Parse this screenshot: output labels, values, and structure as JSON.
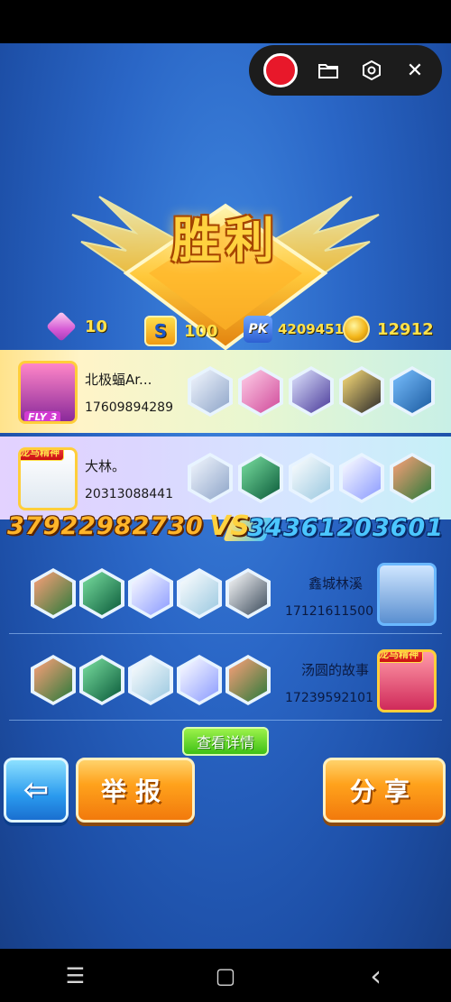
{
  "recorder": {
    "icons": [
      "record-icon",
      "folder-icon",
      "settings-icon",
      "close-icon"
    ],
    "close_glyph": "✕"
  },
  "result": {
    "title": "胜利"
  },
  "stats": {
    "gems": "10",
    "rank_points": "100",
    "pk_score": "4209451",
    "coins": "12912"
  },
  "team_a": [
    {
      "name": "北极蝠Ar...",
      "id": "17609894289",
      "avatar_tag": "",
      "fly_level": "FLY 3"
    },
    {
      "name": "大林。",
      "id": "20313088441",
      "avatar_tag": "龙马精神",
      "fly_level": ""
    }
  ],
  "score": {
    "left": "37922982730",
    "vs": "VS",
    "right": "34361203601"
  },
  "team_b": [
    {
      "name": "鑫城林溪",
      "id": "17121611500",
      "avatar_tag": ""
    },
    {
      "name": "汤圆的故事",
      "id": "17239592101",
      "avatar_tag": "龙马精神"
    }
  ],
  "buttons": {
    "details": "查看详情",
    "report": "举报",
    "share": "分享",
    "back_glyph": "⇦"
  },
  "navigation": {
    "menu": "☰",
    "home": "▢",
    "back": "‹"
  },
  "colors": {
    "record": "#e8182a",
    "gold": "#ffd23f",
    "orange_button": "#ffa21c",
    "back_button": "#2a9aee",
    "score_left": "#ffb52a",
    "score_right": "#4bc6ff"
  }
}
